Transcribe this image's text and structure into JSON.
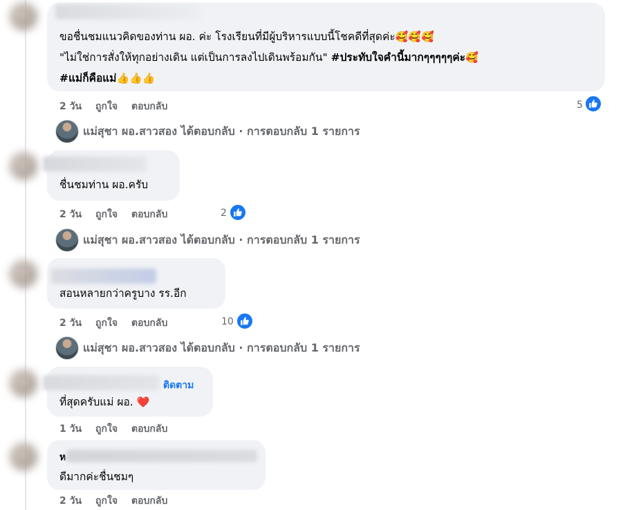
{
  "comments": [
    {
      "lines": [
        {
          "text": "ขอชื่นชมแนวคิดของท่าน ผอ. ค่ะ โรงเรียนที่มีผู้บริหารแบบนี้โชคดีที่สุดค่ะ",
          "emoji": "🥰🥰🥰"
        },
        {
          "text": "\"ไม่ใช่การสั่งให้ทุกอย่างเดิน แต่เป็นการลงไปเดินพร้อมกัน\" ",
          "bold": "#ประทับใจคำนี้มากๆๆๆๆๆค่ะ",
          "emoji": "🥰"
        },
        {
          "bold": "#แม่ก็คือแม่",
          "emoji": "👍👍👍"
        }
      ],
      "time": "2 วัน",
      "like": "ถูกใจ",
      "reply": "ตอบกลับ",
      "likes": "5",
      "reply_summary": "แม่สุชา ผอ.สาวสอง ได้ตอบกลับ · การตอบกลับ 1 รายการ"
    },
    {
      "lines": [
        {
          "text": "ชื่นชมท่าน ผอ.ครับ"
        }
      ],
      "time": "2 วัน",
      "like": "ถูกใจ",
      "reply": "ตอบกลับ",
      "likes": "2",
      "reply_summary": "แม่สุชา ผอ.สาวสอง ได้ตอบกลับ · การตอบกลับ 1 รายการ"
    },
    {
      "lines": [
        {
          "text": "สอนหลายกว่าครูบาง รร.อีก"
        }
      ],
      "time": "2 วัน",
      "like": "ถูกใจ",
      "reply": "ตอบกลับ",
      "likes": "10",
      "reply_summary": "แม่สุชา ผอ.สาวสอง ได้ตอบกลับ · การตอบกลับ 1 รายการ"
    },
    {
      "follow": "ติดตาม",
      "lines": [
        {
          "text": "ที่สุดครับแม่ ผอ. ",
          "emoji": "❤️"
        }
      ],
      "time": "1 วัน",
      "like": "ถูกใจ",
      "reply": "ตอบกลับ"
    },
    {
      "name_initial": "ห",
      "lines": [
        {
          "text": "ดีมากค่ะชื่นชมๆ"
        }
      ],
      "time": "2 วัน",
      "like": "ถูกใจ",
      "reply": "ตอบกลับ"
    }
  ],
  "colors": {
    "like_blue": "#1877f2",
    "bubble_bg": "#f0f2f5",
    "meta_gray": "#65676b"
  }
}
